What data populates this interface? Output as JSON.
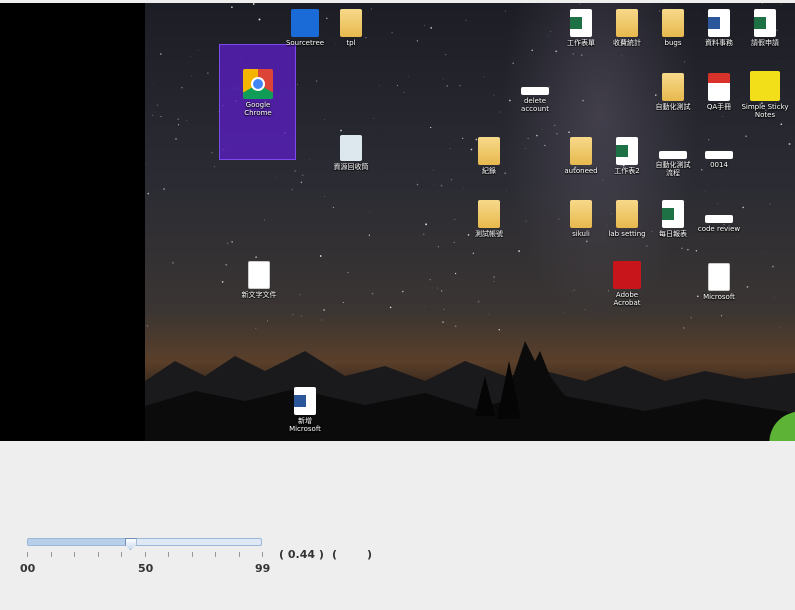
{
  "desktop": {
    "icons": [
      {
        "name": "sourcetree",
        "label": "Sourcetree",
        "kind": "sourcetree-icon"
      },
      {
        "name": "tpl",
        "label": "tpl",
        "kind": "folder-icon"
      },
      {
        "name": "chrome",
        "label": "Google Chrome",
        "kind": "chrome-icon"
      },
      {
        "name": "recycle",
        "label": "資源回收筒",
        "kind": "recycle-bin-icon"
      },
      {
        "name": "doc1",
        "label": "新文字文件",
        "kind": "text-file-icon"
      },
      {
        "name": "word",
        "label": "新增 Microsoft",
        "kind": "word-file-icon"
      },
      {
        "name": "xls-a",
        "label": "工作表單",
        "kind": "excel-file-icon"
      },
      {
        "name": "fold-a",
        "label": "收費統計",
        "kind": "folder-icon"
      },
      {
        "name": "doc-a",
        "label": "bugs",
        "kind": "folder-icon"
      },
      {
        "name": "word-a",
        "label": "資料事務",
        "kind": "word-file-icon"
      },
      {
        "name": "xls-b",
        "label": "請假申請",
        "kind": "excel-file-icon"
      },
      {
        "name": "delete-account",
        "label": "delete account",
        "kind": "file-icon"
      },
      {
        "name": "fold-b",
        "label": "自動化測試",
        "kind": "folder-icon"
      },
      {
        "name": "pdf-a",
        "label": "QA手冊",
        "kind": "pdf-icon"
      },
      {
        "name": "sticky",
        "label": "Simple Sticky Notes",
        "kind": "sticky-notes-icon"
      },
      {
        "name": "fold-c",
        "label": "紀錄",
        "kind": "folder-icon"
      },
      {
        "name": "fold-d",
        "label": "autoneed",
        "kind": "folder-icon"
      },
      {
        "name": "xls-c",
        "label": "工作表2",
        "kind": "excel-file-icon"
      },
      {
        "name": "strip-a",
        "label": "自動化測試流程",
        "kind": "file-icon"
      },
      {
        "name": "strip-b",
        "label": "0014",
        "kind": "file-icon"
      },
      {
        "name": "fold-e",
        "label": "測試帳號",
        "kind": "folder-icon"
      },
      {
        "name": "fold-f",
        "label": "sikuli",
        "kind": "folder-icon"
      },
      {
        "name": "fold-g",
        "label": "lab setting",
        "kind": "folder-icon"
      },
      {
        "name": "xls-d",
        "label": "每日報表",
        "kind": "excel-file-icon"
      },
      {
        "name": "strip-c",
        "label": "code review",
        "kind": "file-icon"
      },
      {
        "name": "acrobat",
        "label": "Adobe Acrobat",
        "kind": "acrobat-icon"
      },
      {
        "name": "ms",
        "label": "Microsoft",
        "kind": "file-icon"
      }
    ]
  },
  "slider": {
    "value": 0.44,
    "min_label": "00",
    "mid_label": "50",
    "max_label": "99",
    "readout": "( 0.44 )",
    "readout2_open": "(",
    "readout2_close": ")"
  }
}
